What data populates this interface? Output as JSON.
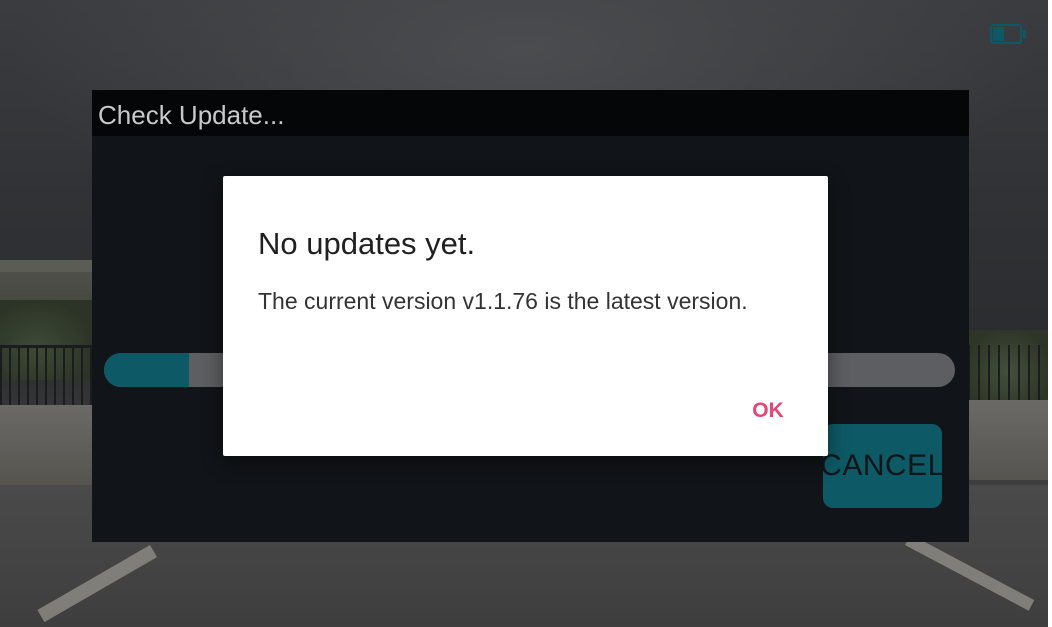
{
  "panel": {
    "title": "Check Update...",
    "progress_fraction": 0.1,
    "cancel_label": "CANCEL"
  },
  "dialog": {
    "title": "No updates yet.",
    "message": "The current version v1.1.76 is the latest version.",
    "ok_label": "OK"
  },
  "status": {
    "icon": "battery-icon"
  },
  "colors": {
    "accent_teal": "#0e5966",
    "ok_pink": "#e8457a",
    "panel_bg": "#111418"
  }
}
